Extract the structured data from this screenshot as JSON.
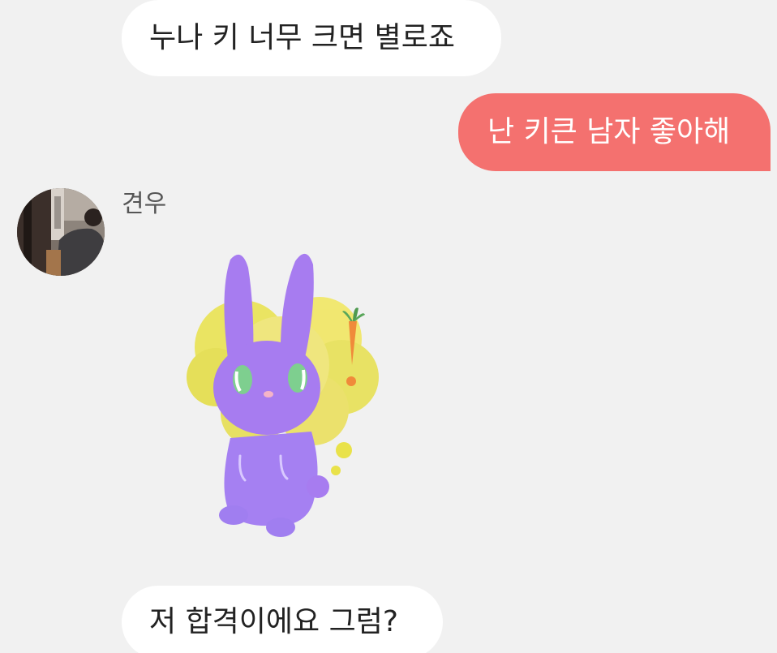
{
  "chat": {
    "messages": [
      {
        "direction": "incoming",
        "text": "누나 키 너무 크면 별로죠"
      },
      {
        "direction": "outgoing",
        "text": "난 키큰 남자 좋아해"
      },
      {
        "direction": "incoming",
        "sender": "견우",
        "content_type": "sticker",
        "sticker": "purple-rabbit-carrot-thought"
      },
      {
        "direction": "incoming",
        "text": "저 합격이에요 그럼?"
      }
    ]
  },
  "colors": {
    "background": "#f1f1f1",
    "incoming_bubble": "#ffffff",
    "outgoing_bubble": "#f4716f"
  },
  "icons": {
    "avatar": "profile-photo-avatar",
    "sticker": "purple-rabbit-sticker-icon"
  }
}
